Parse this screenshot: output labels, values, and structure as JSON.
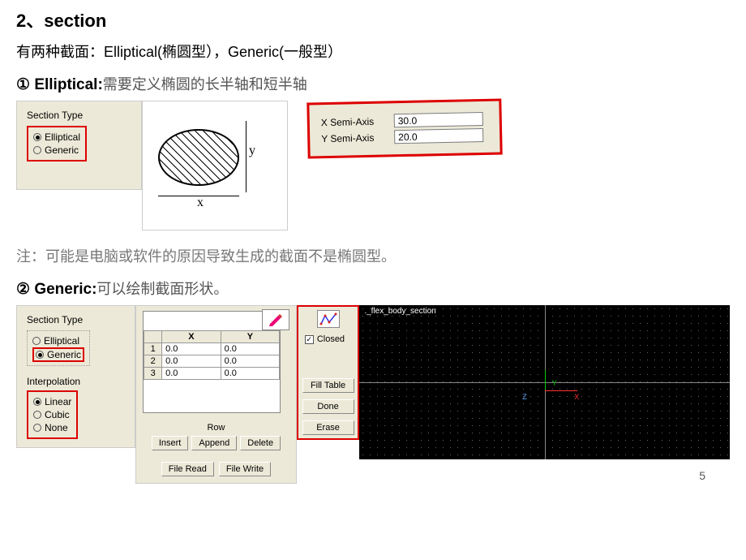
{
  "heading": "2、section",
  "intro": "有两种截面：Elliptical(椭圆型），Generic(一般型）",
  "sub1_num": "①",
  "sub1_label": "Elliptical:",
  "sub1_note": "需要定义椭圆的长半轴和短半轴",
  "section_type_label": "Section Type",
  "radio_elliptical": "Elliptical",
  "radio_generic": "Generic",
  "diagram": {
    "x": "x",
    "y": "y"
  },
  "semi": {
    "x_label": "X Semi-Axis",
    "x_value": "30.0",
    "y_label": "Y Semi-Axis",
    "y_value": "20.0"
  },
  "mid_note": "注：可能是电脑或软件的原因导致生成的截面不是椭圆型。",
  "sub2_num": "②",
  "sub2_label": "Generic:",
  "sub2_note": "可以绘制截面形状。",
  "interpolation_label": "Interpolation",
  "interp_linear": "Linear",
  "interp_cubic": "Cubic",
  "interp_none": "None",
  "table": {
    "col_x": "X",
    "col_y": "Y",
    "rows": [
      {
        "i": "1",
        "x": "0.0",
        "y": "0.0"
      },
      {
        "i": "2",
        "x": "0.0",
        "y": "0.0"
      },
      {
        "i": "3",
        "x": "0.0",
        "y": "0.0"
      }
    ]
  },
  "row_label": "Row",
  "btn_insert": "Insert",
  "btn_append": "Append",
  "btn_delete": "Delete",
  "btn_file_read": "File Read",
  "btn_file_write": "File Write",
  "closed_label": "Closed",
  "btn_fill": "Fill Table",
  "btn_done": "Done",
  "btn_erase": "Erase",
  "preview_title": "._flex_body_section",
  "axis_y": "Y",
  "axis_x": "X",
  "axis_z": "Z",
  "page_number": "5"
}
